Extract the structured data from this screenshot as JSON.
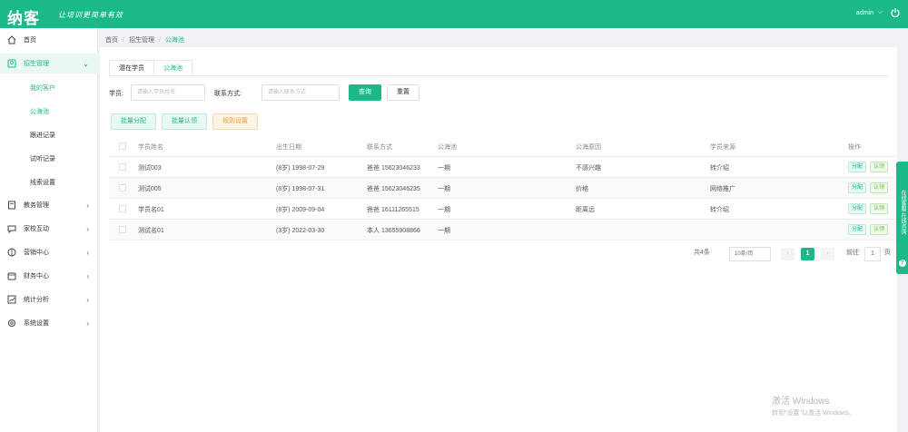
{
  "header": {
    "logo": "纳客",
    "slogan": "让培训更简单有效",
    "user": "admin",
    "user_chevron": "⌵",
    "icons": {
      "power": "power-icon",
      "dropdown": "chevron-down-icon"
    }
  },
  "sidebar": {
    "items": [
      {
        "label": "首页",
        "icon": "home-icon",
        "has_arrow": false
      },
      {
        "label": "招生管理",
        "icon": "user-card-icon",
        "has_arrow": true,
        "active": true,
        "arrow": "⌄"
      },
      {
        "label": "教务管理",
        "icon": "book-icon",
        "has_arrow": true,
        "arrow": "›"
      },
      {
        "label": "家校互动",
        "icon": "chat-icon",
        "has_arrow": true,
        "arrow": "›"
      },
      {
        "label": "营销中心",
        "icon": "gift-icon",
        "has_arrow": true,
        "arrow": "›"
      },
      {
        "label": "财务中心",
        "icon": "wallet-icon",
        "has_arrow": true,
        "arrow": "›"
      },
      {
        "label": "统计分析",
        "icon": "chart-icon",
        "has_arrow": true,
        "arrow": "›"
      },
      {
        "label": "系统设置",
        "icon": "gear-icon",
        "has_arrow": true,
        "arrow": "›"
      }
    ],
    "subitems": [
      {
        "label": "我的客户",
        "active": false
      },
      {
        "label": "公海池",
        "active": true
      },
      {
        "label": "跟进记录",
        "active": false
      },
      {
        "label": "试听记录",
        "active": false
      },
      {
        "label": "线索设置",
        "active": false
      }
    ]
  },
  "breadcrumb": {
    "items": [
      "首页",
      "招生管理",
      "公海池"
    ],
    "separator": "/"
  },
  "tabs": [
    {
      "label": "潜在学员",
      "active": false
    },
    {
      "label": "公海池",
      "active": true
    }
  ],
  "filters": {
    "name_label": "学员:",
    "name_placeholder": "请输入学员姓名",
    "phone_label": "联系方式:",
    "phone_placeholder": "请输入联系方式",
    "search_button": "查询",
    "reset_button": "重置"
  },
  "actions": {
    "batch_assign": "批量分配",
    "batch_claim": "批量认领",
    "export": "规则设置"
  },
  "table": {
    "columns": [
      "学员姓名",
      "出生日期",
      "联系方式",
      "公海池",
      "公海原因",
      "学员来源",
      "操作"
    ],
    "rows": [
      {
        "name": "测试003",
        "birth": "(8岁) 1998-07-29",
        "contact": "爸爸 15623046233",
        "pool": "一期",
        "reason": "不感兴趣",
        "source": "转介绍",
        "op_assign": "分配",
        "op_claim": "认领"
      },
      {
        "name": "测试005",
        "birth": "(8岁) 1998-07-31",
        "contact": "爸爸 15623046235",
        "pool": "一期",
        "reason": "价格",
        "source": "网络推广",
        "op_assign": "分配",
        "op_claim": "认领"
      },
      {
        "name": "学员名01",
        "birth": "(8岁) 2009-09-04",
        "contact": "爸爸 16111265515",
        "pool": "一期",
        "reason": "距离远",
        "source": "转介绍",
        "op_assign": "分配",
        "op_claim": "认领"
      },
      {
        "name": "测试名01",
        "birth": "(3岁) 2022-03-30",
        "contact": "本人 13655908866",
        "pool": "一期",
        "reason": "",
        "source": "",
        "op_assign": "分配",
        "op_claim": "认领"
      }
    ]
  },
  "pagination": {
    "total": "共4条",
    "page_size": "10条/页",
    "prev": "‹",
    "current": "1",
    "next": "›",
    "goto_label": "前往",
    "goto_value": "1",
    "goto_suffix": "页"
  },
  "side_float": {
    "text": "在线客服 在线咨询",
    "icon_label": "?"
  },
  "watermark": {
    "title": "激活 Windows",
    "subtitle": "转到\"设置\"以激活 Windows。"
  },
  "colors": {
    "brand": "#1bb98a",
    "warning": "#e6a23c",
    "success": "#67c23a"
  }
}
